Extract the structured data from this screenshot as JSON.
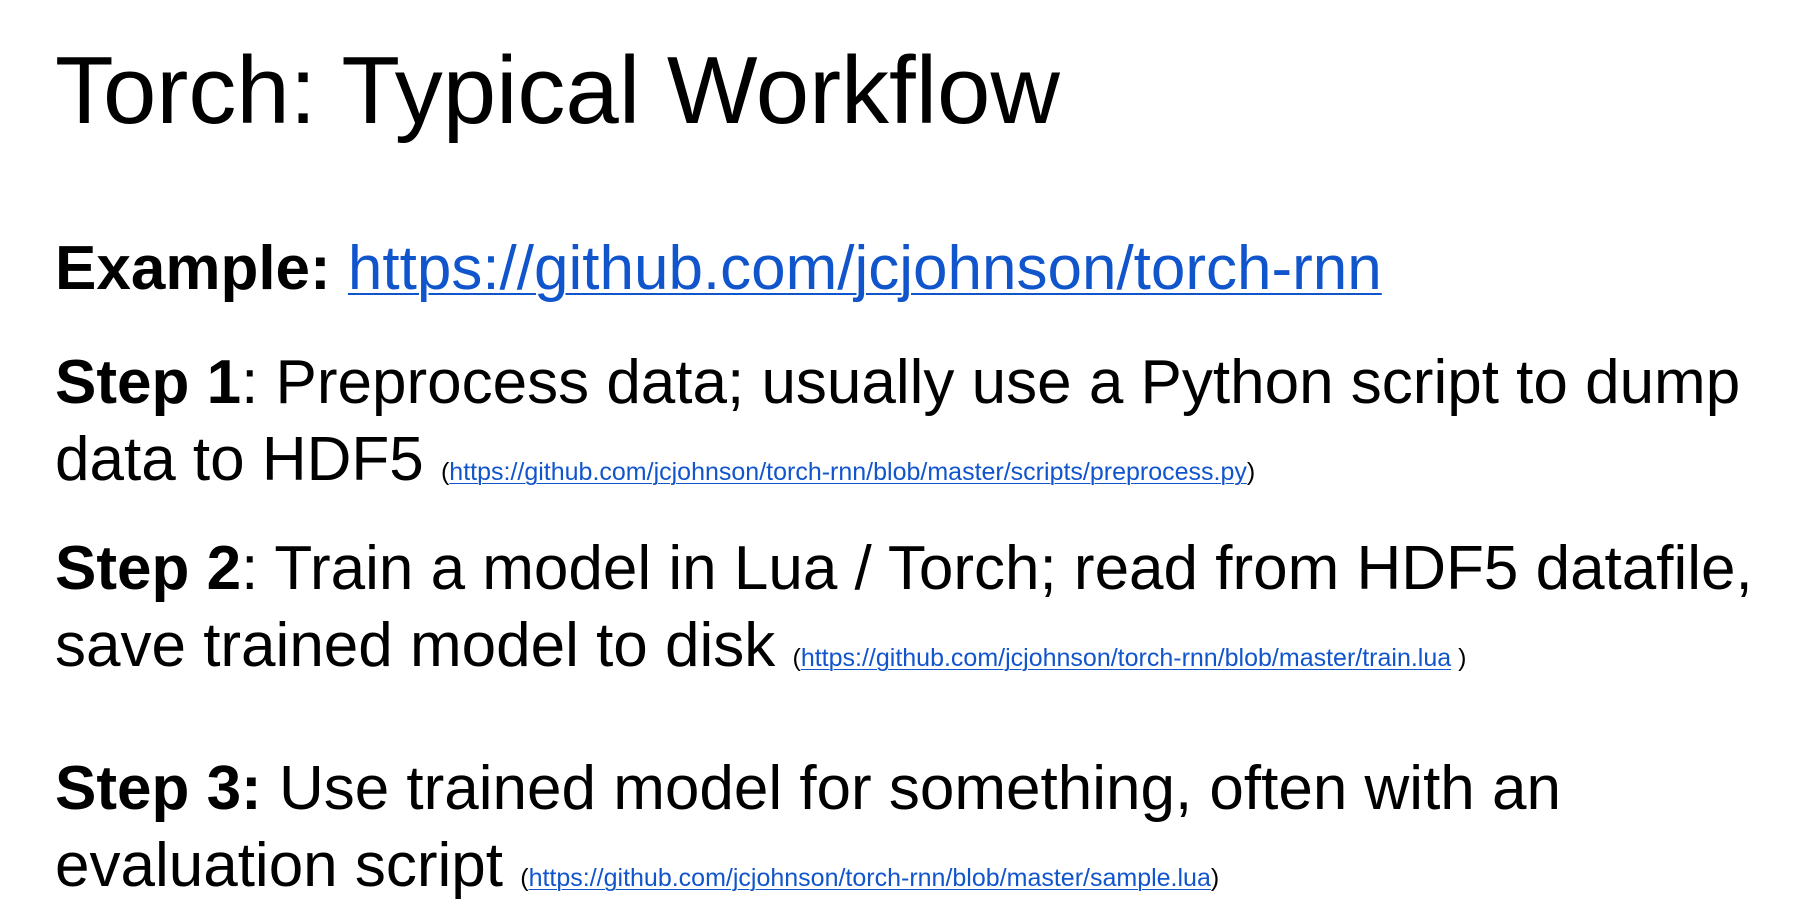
{
  "slide": {
    "title": "Torch: Typical Workflow",
    "example": {
      "label": "Example:",
      "url": "https://github.com/jcjohnson/torch-rnn"
    },
    "steps": [
      {
        "label": "Step 1",
        "separator": ":",
        "text": " Preprocess data; usually use a Python script to dump data to HDF5 ",
        "open_paren": "(",
        "url": "https://github.com/jcjohnson/torch-rnn/blob/master/scripts/preprocess.py",
        "close_paren": ")"
      },
      {
        "label": "Step 2",
        "separator": ":",
        "text": " Train a model in Lua / Torch; read from HDF5 datafile, save trained model to disk ",
        "open_paren": "(",
        "url": "https://github.com/jcjohnson/torch-rnn/blob/master/train.lua",
        "close_paren": " )"
      },
      {
        "label": "Step 3:",
        "separator": "",
        "text": " Use trained model for something, often with an evaluation script ",
        "open_paren": "(",
        "url": "https://github.com/jcjohnson/torch-rnn/blob/master/sample.lua",
        "close_paren": ")"
      }
    ],
    "colors": {
      "text": "#000000",
      "link": "#1155cc",
      "background": "#ffffff"
    }
  }
}
